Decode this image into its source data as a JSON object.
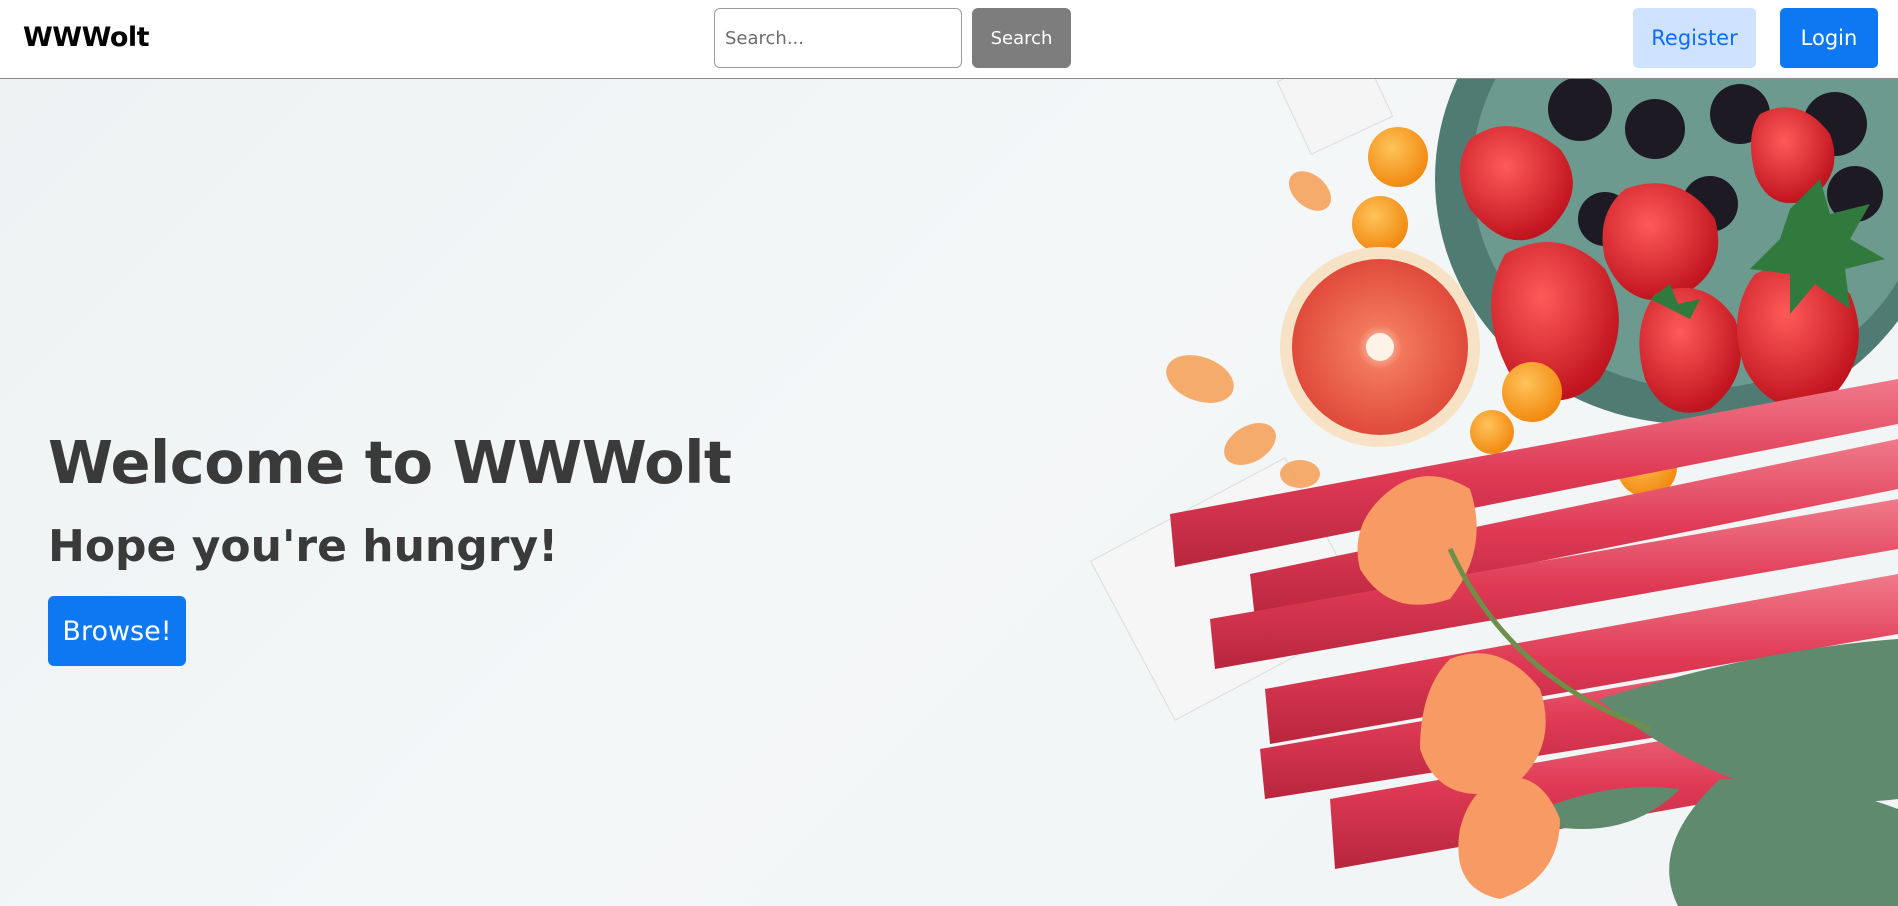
{
  "navbar": {
    "brand": "WWWolt",
    "search_placeholder": "Search...",
    "search_label": "Search",
    "register_label": "Register",
    "login_label": "Login"
  },
  "hero": {
    "title": "Welcome to WWWolt",
    "subtitle": "Hope you're hungry!",
    "browse_label": "Browse!",
    "image_subject": "fruit-and-flowers-photo"
  },
  "colors": {
    "primary": "#0d78f2",
    "primary_light": "#cfe2ff",
    "secondary": "#7d7d7d",
    "heading_text": "#3a3a3a"
  }
}
